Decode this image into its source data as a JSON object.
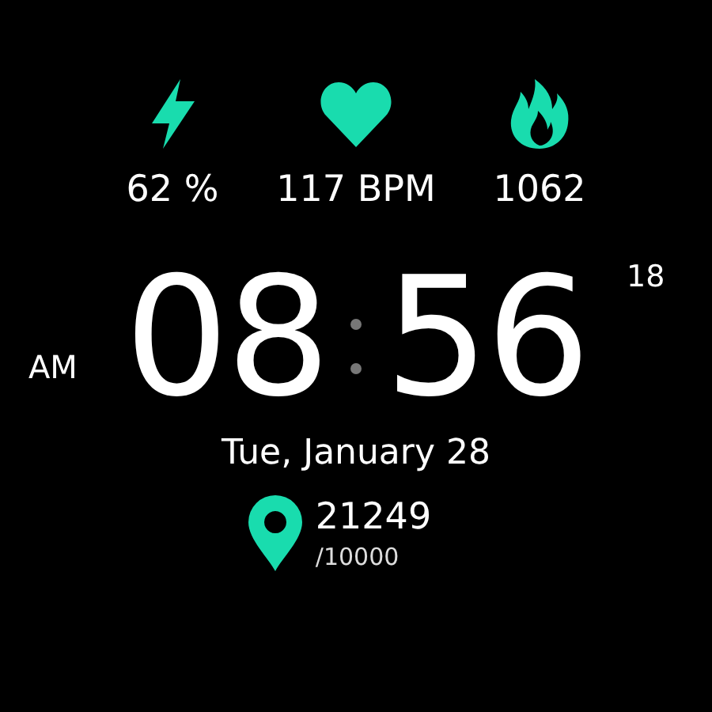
{
  "stats": [
    {
      "kind": "battery",
      "value": "62 %"
    },
    {
      "kind": "heart",
      "value": "117 BPM"
    },
    {
      "kind": "flame",
      "value": "1062"
    }
  ],
  "time": {
    "period": "AM",
    "hours": "08",
    "minutes": "56",
    "seconds": "18"
  },
  "date": "Tue, January 28",
  "steps": {
    "count": "21249",
    "goal": "/10000"
  }
}
